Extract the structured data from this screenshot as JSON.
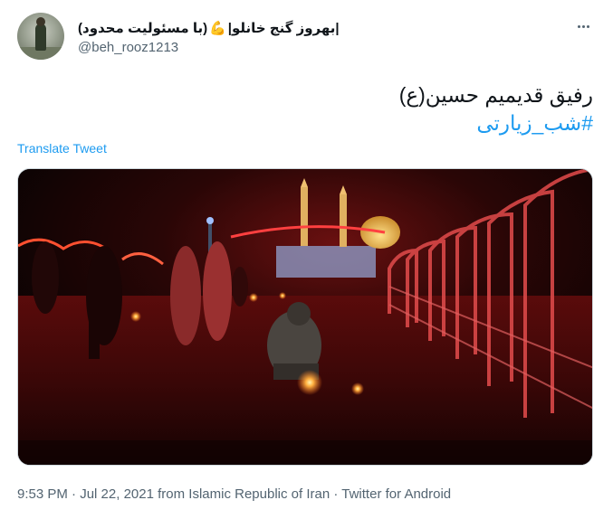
{
  "user": {
    "display_name_prefix": "|بهروز گنج خانلو|",
    "display_name_emoji": "💪",
    "display_name_suffix": "(با مسئولیت محدود)",
    "handle": "@beh_rooz1213",
    "avatar_icon": "profile-photo"
  },
  "tweet": {
    "text": "رفیق قدیمیم حسین(ع)",
    "hashtag": "#شب_زیارتی",
    "translate_label": "Translate Tweet",
    "more_icon": "ellipsis-icon"
  },
  "meta": {
    "time": "9:53 PM",
    "date": "Jul 22, 2021",
    "location": "from Islamic Republic of Iran",
    "source": "Twitter for Android",
    "separator": " · "
  },
  "colors": {
    "accent": "#1d9bf0",
    "secondary_text": "#536471",
    "primary_text": "#0f1419"
  }
}
